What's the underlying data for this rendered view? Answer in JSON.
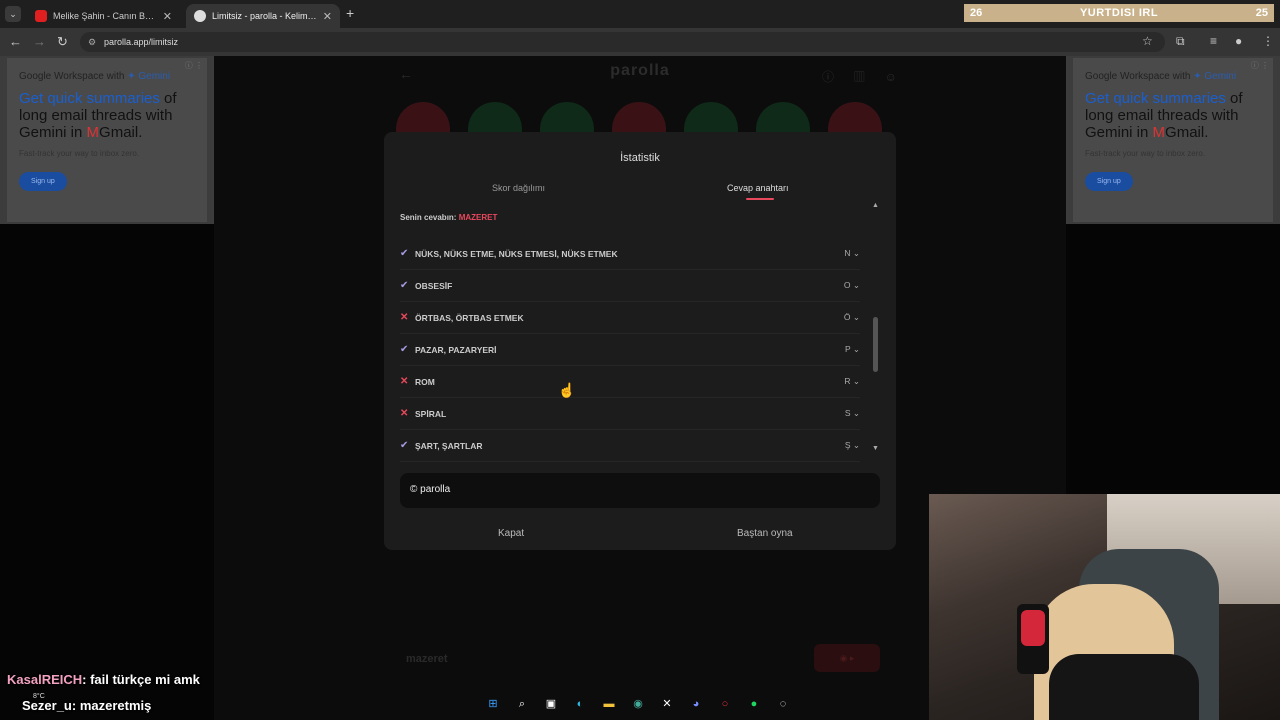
{
  "browser": {
    "tabs": [
      {
        "title": "Melike Şahin - Canın Beni Çekti",
        "active": false,
        "favicon_color": "#e02020"
      },
      {
        "title": "Limitsiz - parolla - Kelime oyunu",
        "active": true,
        "favicon_color": "#dddddd"
      }
    ],
    "url": "parolla.app/limitsiz"
  },
  "stream_overlay": {
    "left": "26",
    "center": "YURTDISI IRL",
    "right": "25"
  },
  "ads": [
    {
      "header": "Google Workspace with",
      "brand": "Gemini",
      "title_blue": "Get quick summaries",
      "title_rest": "of long email threads with Gemini in",
      "title_gmail": "Gmail.",
      "sub": "Fast-track your way to inbox zero.",
      "cta": "Sign up"
    },
    {
      "header": "Google Workspace with",
      "brand": "Gemini",
      "title_blue": "Get quick summaries",
      "title_rest": "of long email threads with Gemini in",
      "title_gmail": "Gmail.",
      "sub": "Fast-track your way to inbox zero.",
      "cta": "Sign up"
    }
  ],
  "game": {
    "logo": "parolla",
    "input_value": "mazeret",
    "letter_circle_colors": [
      "#3a1216",
      "#0f2a18",
      "#0f2a18",
      "#3a1216",
      "#0f2a18",
      "#0f2a18",
      "#3a1216"
    ]
  },
  "modal": {
    "title": "İstatistik",
    "tabs": [
      {
        "label": "Skor dağılımı",
        "active": false
      },
      {
        "label": "Cevap anahtarı",
        "active": true
      }
    ],
    "your_answer_label": "Senin cevabın:",
    "your_answer": "MAZERET",
    "answers": [
      {
        "text": "NÜKS, NÜKS ETME, NÜKS ETMESİ, NÜKS ETMEK",
        "letter": "N",
        "correct": true
      },
      {
        "text": "OBSESİF",
        "letter": "O",
        "correct": true
      },
      {
        "text": "ÖRTBAS, ÖRTBAS ETMEK",
        "letter": "Ö",
        "correct": false
      },
      {
        "text": "PAZAR, PAZARYERİ",
        "letter": "P",
        "correct": true
      },
      {
        "text": "ROM",
        "letter": "R",
        "correct": false
      },
      {
        "text": "SPİRAL",
        "letter": "S",
        "correct": false
      },
      {
        "text": "ŞART, ŞARTLAR",
        "letter": "Ş",
        "correct": true
      }
    ],
    "footer": "© parolla",
    "close_label": "Kapat",
    "replay_label": "Baştan oyna"
  },
  "chat": [
    {
      "user": "KasalREICH",
      "message": ": fail türkçe mi amk"
    },
    {
      "user": "Sezer_u",
      "message": ": mazeretmiş"
    }
  ],
  "weather": "8°C",
  "taskbar_icons": [
    "windows-icon",
    "search-icon",
    "task-view-icon",
    "edge-icon",
    "folder-icon",
    "chrome-icon",
    "x-icon",
    "discord-icon",
    "opera-icon",
    "spotify-icon",
    "app-icon"
  ]
}
